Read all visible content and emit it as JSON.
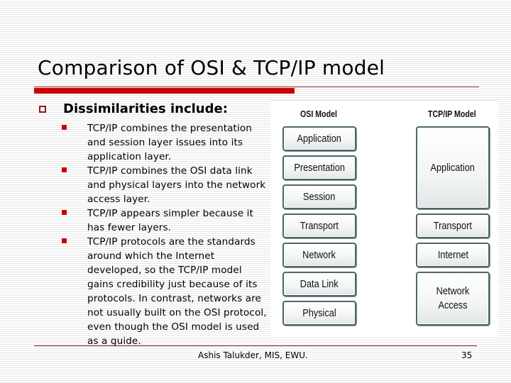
{
  "slide": {
    "title": "Comparison of OSI & TCP/IP model",
    "heading": "Dissimilarities include:",
    "bullets": [
      "TCP/IP combines the presentation and session layer issues into its application layer.",
      "TCP/IP combines the OSI data link and physical layers into the network access layer.",
      "TCP/IP appears simpler because it has fewer layers.",
      "TCP/IP protocols are the standards around which the Internet developed, so the TCP/IP model gains credibility just because of its protocols. In contrast, networks are not usually built on the OSI protocol, even though the OSI model is used as a guide."
    ],
    "footer": "Ashis Talukder, MIS, EWU.",
    "page_number": "35",
    "colors": {
      "accent_red": "#cc0000",
      "rule_dark_red": "#8b1a1a",
      "layer_border": "#4e6666"
    }
  },
  "diagram": {
    "osi_title": "OSI Model",
    "tcpip_title": "TCP/IP Model",
    "osi_layers": [
      "Application",
      "Presentation",
      "Session",
      "Transport",
      "Network",
      "Data Link",
      "Physical"
    ],
    "tcpip_layers": [
      {
        "label": "Application",
        "spans": [
          "Application",
          "Presentation",
          "Session"
        ]
      },
      {
        "label": "Transport",
        "spans": [
          "Transport"
        ]
      },
      {
        "label": "Internet",
        "spans": [
          "Network"
        ]
      },
      {
        "label": "Network Access",
        "spans": [
          "Data Link",
          "Physical"
        ]
      }
    ]
  }
}
